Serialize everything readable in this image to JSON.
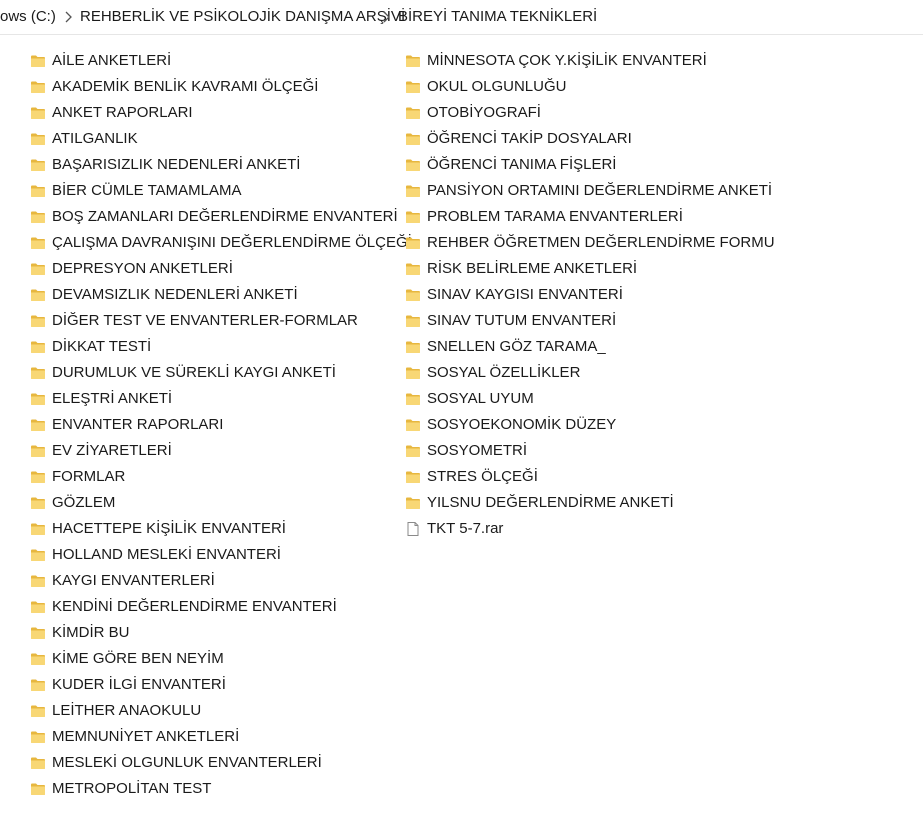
{
  "breadcrumb": {
    "items": [
      "ows (C:)",
      "REHBERLİK VE PSİKOLOJİK DANIŞMA ARŞİVİ",
      "BİREYİ TANIMA TEKNİKLERİ"
    ]
  },
  "icons": {
    "folder": "folder-icon",
    "file": "file-icon",
    "chevron": "chevron-right-icon"
  },
  "colors": {
    "folder_fill": "#f8d775",
    "folder_tab": "#e7b73f"
  },
  "files": {
    "column1": [
      "AİLE ANKETLERİ",
      "AKADEMİK BENLİK KAVRAMI ÖLÇEĞİ",
      "ANKET RAPORLARI",
      "ATILGANLIK",
      "BAŞARISIZLIK NEDENLERİ ANKETİ",
      "BİER CÜMLE TAMAMLAMA",
      "BOŞ ZAMANLARI DEĞERLENDİRME ENVANTERİ",
      "ÇALIŞMA DAVRANIŞINI DEĞERLENDİRME ÖLÇEĞİ",
      "DEPRESYON ANKETLERİ",
      "DEVAMSIZLIK NEDENLERİ ANKETİ",
      "DİĞER TEST VE ENVANTERLER-FORMLAR",
      "DİKKAT TESTİ",
      "DURUMLUK VE SÜREKLİ KAYGI ANKETİ",
      "ELEŞTRİ ANKETİ",
      "ENVANTER RAPORLARI",
      "EV ZİYARETLERİ",
      "FORMLAR",
      "GÖZLEM",
      "HACETTEPE KİŞİLİK ENVANTERİ",
      "HOLLAND MESLEKİ ENVANTERİ",
      "KAYGI ENVANTERLERİ",
      "KENDİNİ DEĞERLENDİRME ENVANTERİ",
      "KİMDİR BU",
      "KİME GÖRE BEN NEYİM",
      "KUDER İLGİ ENVANTERİ",
      "LEİTHER ANAOKULU",
      "MEMNUNİYET ANKETLERİ",
      "MESLEKİ OLGUNLUK ENVANTERLERİ",
      "METROPOLİTAN TEST"
    ],
    "column2": [
      "MİNNESOTA ÇOK Y.KİŞİLİK ENVANTERİ",
      "OKUL OLGUNLUĞU",
      "OTOBİYOGRAFİ",
      "ÖĞRENCİ TAKİP DOSYALARI",
      "ÖĞRENCİ TANIMA FİŞLERİ",
      "PANSİYON ORTAMINI DEĞERLENDİRME ANKETİ",
      "PROBLEM TARAMA ENVANTERLERİ",
      "REHBER ÖĞRETMEN DEĞERLENDİRME FORMU",
      "RİSK BELİRLEME ANKETLERİ",
      "SINAV KAYGISI ENVANTERİ",
      "SINAV TUTUM ENVANTERİ",
      "SNELLEN GÖZ TARAMA_",
      "SOSYAL ÖZELLİKLER",
      "SOSYAL UYUM",
      "SOSYOEKONOMİK DÜZEY",
      "SOSYOMETRİ",
      "STRES ÖLÇEĞİ",
      "YILSNU DEĞERLENDİRME ANKETİ"
    ],
    "file_item": "TKT 5-7.rar"
  }
}
